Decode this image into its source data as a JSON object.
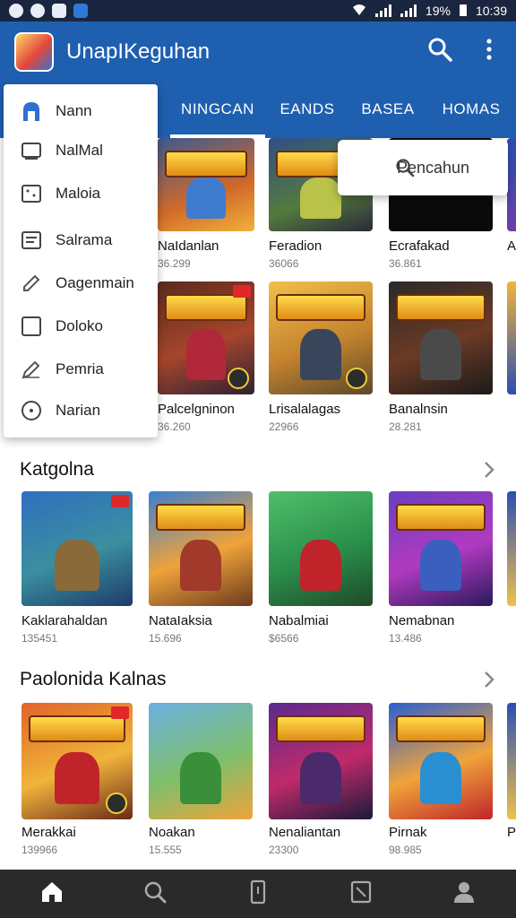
{
  "status_bar": {
    "signal_text": "19%",
    "time": "10:39"
  },
  "app_bar": {
    "title": "UnapIKeguhan"
  },
  "tabs": [
    {
      "label": "NINGCAN",
      "active": true
    },
    {
      "label": "EANDS",
      "active": false
    },
    {
      "label": "BASEA",
      "active": false
    },
    {
      "label": "HOMAS",
      "active": false
    }
  ],
  "search_popup": {
    "placeholder": "Pencahun"
  },
  "drawer": {
    "items": [
      {
        "label": "Nann",
        "icon": "person-icon"
      },
      {
        "label": "NalMal",
        "icon": "window-icon"
      },
      {
        "label": "Maloia",
        "icon": "image-icon"
      },
      {
        "label": "Salrama",
        "icon": "list-icon"
      },
      {
        "label": "Oagenmain",
        "icon": "pencil-icon"
      },
      {
        "label": "Doloko",
        "icon": "checkbox-icon"
      },
      {
        "label": "Pemria",
        "icon": "edit-icon"
      },
      {
        "label": "Narian",
        "icon": "info-circle-icon"
      }
    ]
  },
  "top_grid": {
    "row1": [
      {
        "name": "NaIdanlan",
        "count": "36.299"
      },
      {
        "name": "Feradion",
        "count": "36066"
      },
      {
        "name": "Ecrafakad",
        "count": "36.861"
      },
      {
        "name": "A",
        "count": ""
      }
    ],
    "row2": [
      {
        "name": "Palcelgninon",
        "count": "36.260"
      },
      {
        "name": "Lrisalalagas",
        "count": "22966"
      },
      {
        "name": "Banalnsin",
        "count": "28.281"
      }
    ]
  },
  "section1": {
    "title": "Katgolna",
    "items": [
      {
        "name": "Kaklarahaldan",
        "count": "135451"
      },
      {
        "name": "NataIaksia",
        "count": "15.696"
      },
      {
        "name": "Nabalmiai",
        "count": "$6566"
      },
      {
        "name": "Nemabnan",
        "count": "13.486"
      }
    ]
  },
  "section2": {
    "title": "Paolonida Kalnas",
    "items": [
      {
        "name": "Merakkai",
        "count": "139966"
      },
      {
        "name": "Noakan",
        "count": "15.555"
      },
      {
        "name": "Nenaliantan",
        "count": "23300"
      },
      {
        "name": "Pirnak",
        "count": "98.985"
      },
      {
        "name": "P",
        "count": ""
      }
    ]
  },
  "bottom_nav": [
    "home-icon",
    "search-icon",
    "phone-icon",
    "tablet-icon",
    "profile-icon"
  ],
  "colors": {
    "app_bar": "#1f5fb0",
    "status_bar": "#1a2640",
    "bottom_nav": "#2a2a2a"
  }
}
